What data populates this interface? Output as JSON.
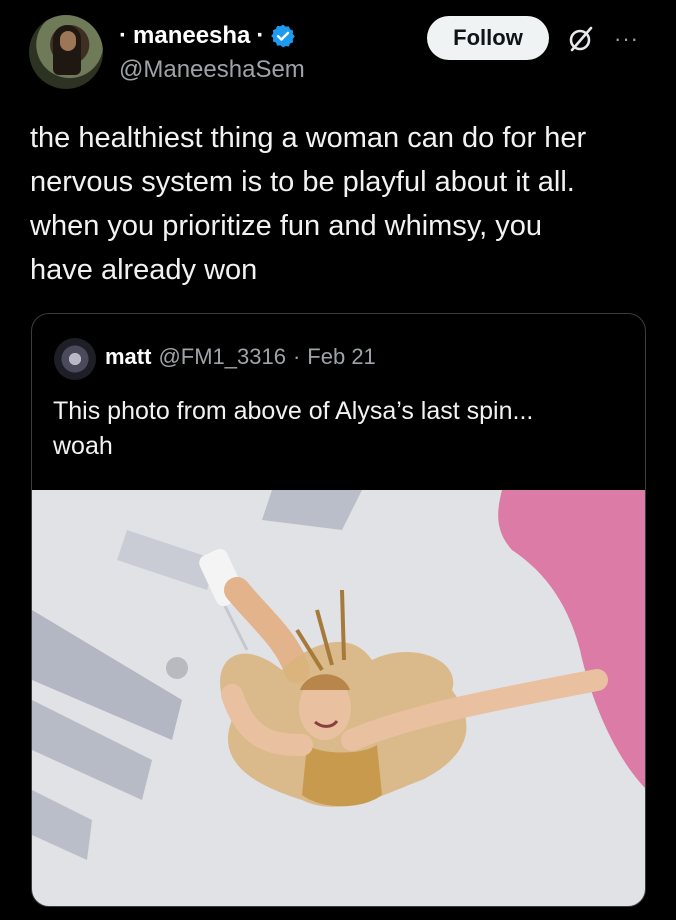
{
  "author": {
    "name_prefix": "·",
    "name": "maneesha",
    "name_suffix": "·",
    "handle": "@ManeeshaSem"
  },
  "actions": {
    "follow_label": "Follow",
    "more_label": "···"
  },
  "tweet": {
    "text": "the healthiest thing a woman can do for her\nnervous system is to be playful about it all.\nwhen you prioritize fun and whimsy, you\nhave already won"
  },
  "quoted": {
    "name": "matt",
    "handle": "@FM1_3316",
    "separator": "·",
    "date": "Feb 21",
    "text": "This photo from above of Alysa’s last spin...\nwoah"
  },
  "colors": {
    "background": "#000000",
    "verified": "#1d9bf0",
    "muted": "#9ea3a8",
    "rink_pink": "#d9689a"
  }
}
